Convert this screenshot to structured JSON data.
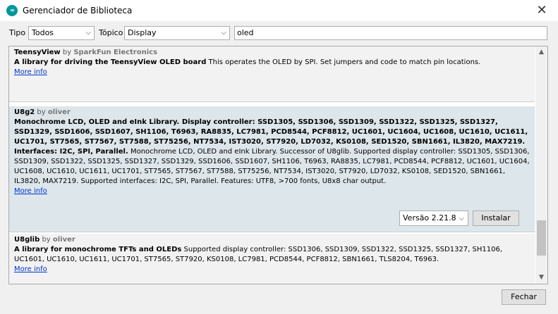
{
  "window": {
    "title": "Gerenciador de Biblioteca",
    "close_glyph": "✕",
    "app_icon": "arduino-icon"
  },
  "filters": {
    "type_label": "Tipo",
    "type_value": "Todos",
    "topic_label": "Tópico",
    "topic_value": "Display",
    "search_value": "oled"
  },
  "libraries": [
    {
      "name": "TeensyView",
      "by": "by",
      "author": "SparkFun Electronics",
      "summary": "A library for driving the TeensyView OLED board",
      "description": " This operates the OLED by SPI. Set jumpers and code to match pin locations.",
      "more": "More info"
    },
    {
      "name": "U8g2",
      "by": "by",
      "author": "oliver",
      "summary": "Monochrome LCD, OLED and eInk Library. Display controller: SSD1305, SSD1306, SSD1309, SSD1322, SSD1325, SSD1327, SSD1329, SSD1606, SSD1607, SH1106, T6963, RA8835, LC7981, PCD8544, PCF8812, UC1601, UC1604, UC1608, UC1610, UC1611, UC1701, ST7565, ST7567, ST7588, ST75256, NT7534, IST3020, ST7920, LD7032, KS0108, SED1520, SBN1661, IL3820, MAX7219. Interfaces: I2C, SPI, Parallel.",
      "description": " Monochrome LCD, OLED and eInk Library. Successor of U8glib. Supported display controller: SSD1305, SSD1306, SSD1309, SSD1322, SSD1325, SSD1327, SSD1329, SSD1606, SSD1607, SH1106, T6963, RA8835, LC7981, PCD8544, PCF8812, UC1601, UC1604, UC1608, UC1610, UC1611, UC1701, ST7565, ST7567, ST7588, ST75256, NT7534, IST3020, ST7920, LD7032, KS0108, SED1520, SBN1661, IL3820, MAX7219. Supported interfaces: I2C, SPI, Parallel. Features: UTF8, >700 fonts, U8x8 char output.",
      "more": "More info",
      "version": "Versão 2.21.8",
      "install": "Instalar"
    },
    {
      "name": "U8glib",
      "by": "by",
      "author": "oliver",
      "summary": "A library for monochrome TFTs and OLEDs",
      "description": " Supported display controller: SSD1306, SSD1309, SSD1322, SSD1325, SSD1327, SH1106, UC1601, UC1610, UC1611, UC1701, ST7565, ST7920, KS0108, LC7981, PCD8544, PCF8812, SBN1661, TLS8204, T6963.",
      "more": "More info"
    }
  ],
  "footer": {
    "close_label": "Fechar"
  },
  "colors": {
    "link": "#0033cc",
    "selected_row": "#dde6ea",
    "row": "#f2f2f2"
  }
}
